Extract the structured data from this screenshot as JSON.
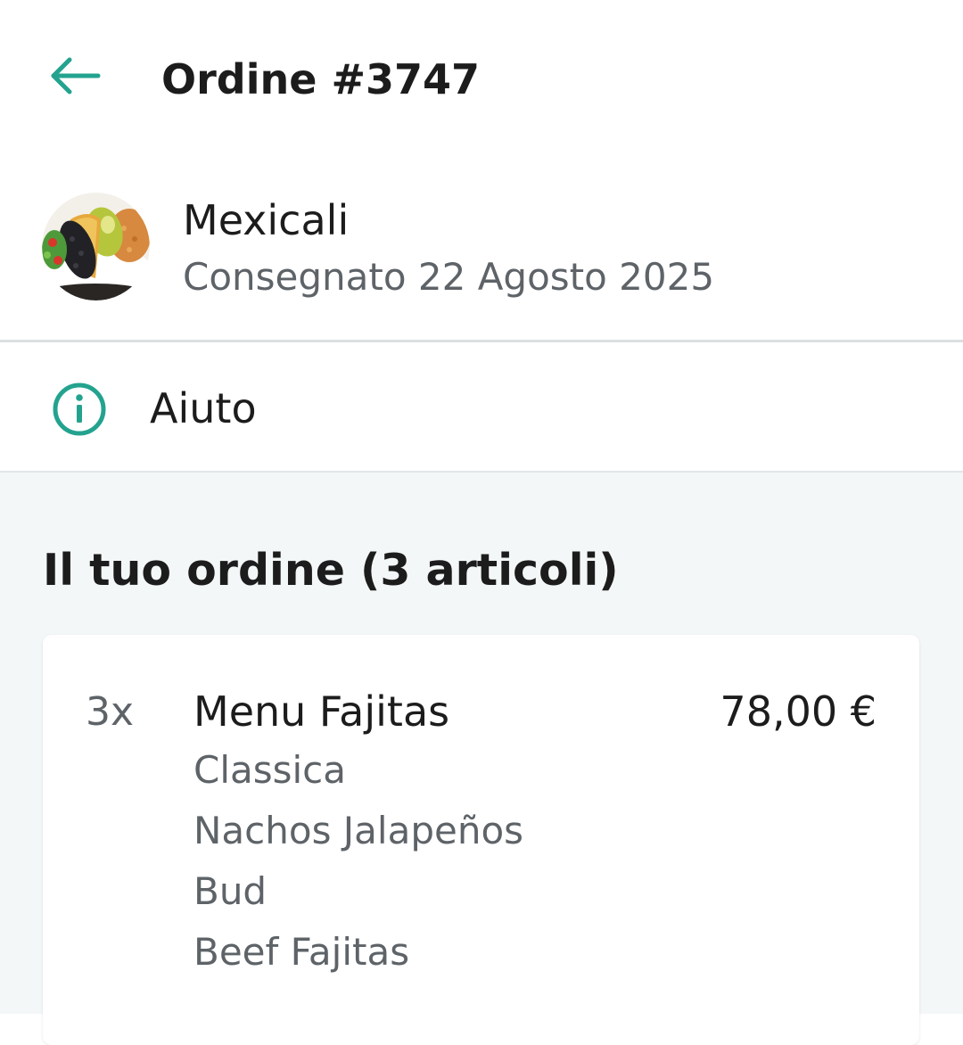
{
  "header": {
    "back_icon": "arrow-left-icon",
    "title": "Ordine #3747"
  },
  "restaurant": {
    "image_icon": "food-plate-image",
    "name": "Mexicali",
    "status": "Consegnato 22 Agosto 2025"
  },
  "help": {
    "icon": "info-circle-icon",
    "label": "Aiuto"
  },
  "order": {
    "heading": "Il tuo ordine (3 articoli)",
    "items": [
      {
        "quantity": "3x",
        "name": "Menu Fajitas",
        "price": "78,00 €",
        "options": [
          "Classica",
          "Nachos Jalapeños",
          "Bud",
          "Beef Fajitas"
        ]
      }
    ]
  },
  "colors": {
    "accent": "#23a38f",
    "text_primary": "#1c1c1c",
    "text_secondary": "#5e6368",
    "section_background": "#f4f7f8",
    "divider": "#dcdfe1"
  }
}
